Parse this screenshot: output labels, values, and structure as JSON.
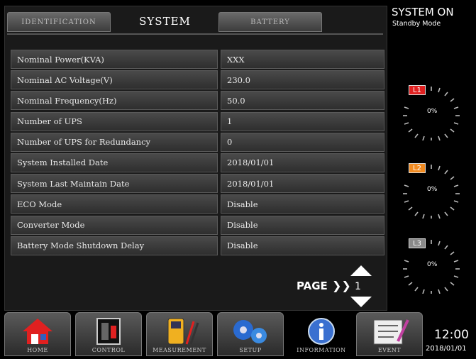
{
  "tabs": [
    {
      "label": "IDENTIFICATION",
      "active": false
    },
    {
      "label": "SYSTEM",
      "active": true
    },
    {
      "label": "BATTERY",
      "active": false
    }
  ],
  "rows": [
    {
      "label": "Nominal Power(KVA)",
      "value": "XXX"
    },
    {
      "label": "Nominal AC Voltage(V)",
      "value": "230.0"
    },
    {
      "label": "Nominal Frequency(Hz)",
      "value": "50.0"
    },
    {
      "label": "Number of UPS",
      "value": "1"
    },
    {
      "label": "Number of UPS for Redundancy",
      "value": "0"
    },
    {
      "label": "System Installed Date",
      "value": "2018/01/01"
    },
    {
      "label": "System Last Maintain Date",
      "value": "2018/01/01"
    },
    {
      "label": "ECO Mode",
      "value": "Disable"
    },
    {
      "label": "Converter Mode",
      "value": "Disable"
    },
    {
      "label": "Battery Mode Shutdown Delay",
      "value": "Disable"
    }
  ],
  "pagination": {
    "label": "PAGE",
    "arrow": "❯❯",
    "page": "1"
  },
  "status": {
    "title": "SYSTEM ON",
    "mode": "Standby Mode"
  },
  "gauges": [
    {
      "label": "L1",
      "percent": "0%",
      "color": "#e02020"
    },
    {
      "label": "L2",
      "percent": "0%",
      "color": "#f08a20"
    },
    {
      "label": "L3",
      "percent": "0%",
      "color": "#8a8a8a"
    }
  ],
  "nav": [
    {
      "label": "HOME",
      "icon": "home-icon"
    },
    {
      "label": "CONTROL",
      "icon": "control-icon"
    },
    {
      "label": "MEASUREMENT",
      "icon": "measurement-icon"
    },
    {
      "label": "SETUP",
      "icon": "gear-icon"
    },
    {
      "label": "INFORMATION",
      "icon": "info-icon",
      "active": true
    },
    {
      "label": "EVENT",
      "icon": "event-icon"
    }
  ],
  "clock": {
    "time": "12:00",
    "date": "2018/01/01"
  }
}
